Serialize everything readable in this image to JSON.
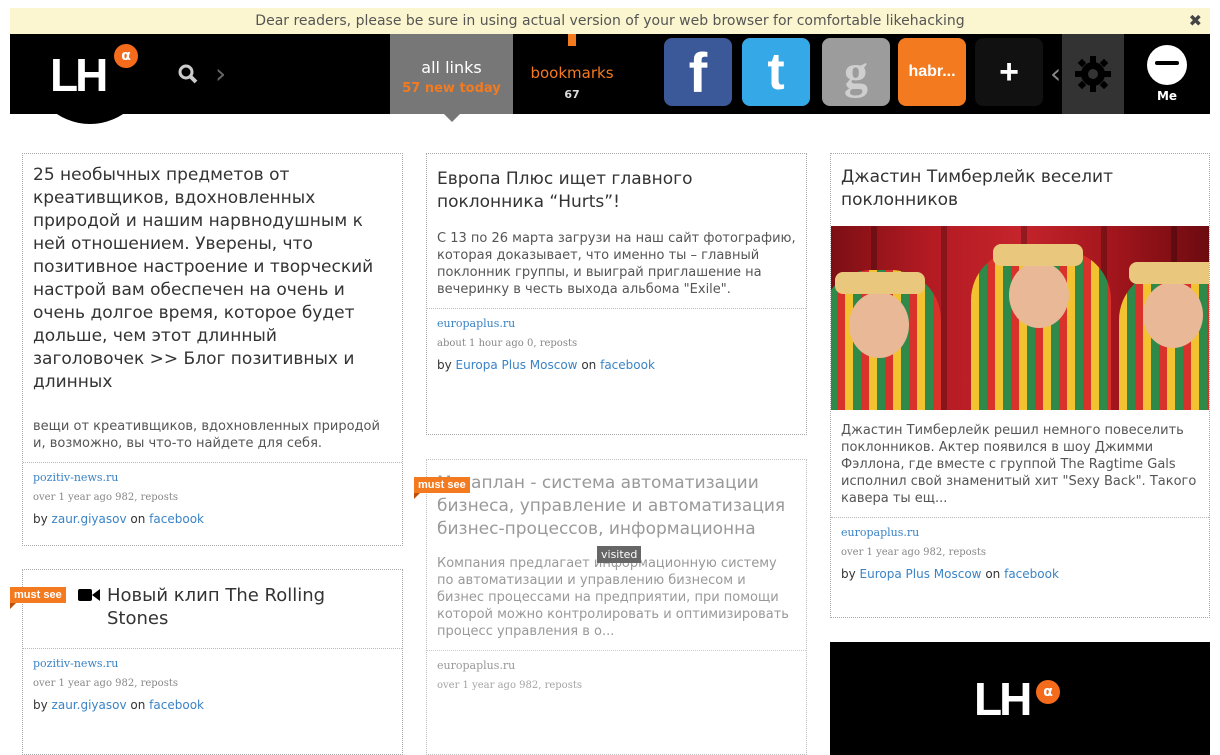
{
  "notice": {
    "text": "Dear readers, please be sure in using actual version of your web browser for comfortable likehacking",
    "close": "✖"
  },
  "header": {
    "logo": "LH",
    "logo_badge": "α",
    "search_icon": "search-icon",
    "tabs": {
      "all_links": {
        "label": "all links",
        "sub": "57 new today"
      },
      "bookmarks": {
        "label": "bookmarks",
        "count": "67"
      }
    },
    "social": {
      "facebook": "f",
      "twitter": "t",
      "google": "g",
      "habr": "habr...",
      "plus": "+"
    },
    "me_label": "Me"
  },
  "cards": [
    {
      "title": "25 необычных предметов от креативщиков, вдохновленных природой и нашим нарвнодушным к ней отношением. Уверены, что позитивное настроение и творческий настрой вам обеспечен на очень и очень долгое время, которое будет дольше, чем этот длинный заголовочек >> Блог позитивных и длинных",
      "desc": "вещи от креативщиков, вдохновленных природой и, возможно, вы что-то найдете для себя.",
      "source": "pozitiv-news.ru",
      "time": "over 1 year ago 982, reposts",
      "by_prefix": "by",
      "author": "zaur.giyasov",
      "on": "on",
      "network": "facebook"
    },
    {
      "badge": "must see",
      "title": "Новый клип The Rolling Stones",
      "source": "pozitiv-news.ru",
      "time": "over 1 year ago 982, reposts",
      "by_prefix": "by",
      "author": "zaur.giyasov",
      "on": "on",
      "network": "facebook"
    },
    {
      "title": "Европа Плюс ищет главного поклонника “Hurts”!",
      "desc": "С 13 по 26 марта загрузи на наш сайт фотографию, которая доказывает, что именно ты – главный поклонник группы, и выиграй приглашение на вечеринку в честь выхода альбома \"Exile\".",
      "source": "europaplus.ru",
      "time": "about 1 hour ago 0, reposts",
      "by_prefix": "by",
      "author": "Europa Plus Moscow",
      "on": "on",
      "network": "facebook"
    },
    {
      "badge": "must see",
      "visited": "visited",
      "title": "Мегаплан - система автоматизации бизнеса, управление и автоматизация бизнес-процессов, информационна",
      "desc": "Компания предлагает информационную систему по автоматизации и управлению бизнесом и бизнес процессами на предприятии, при помощи которой можно контролировать и оптимизировать процесс управления в о...",
      "source": "europaplus.ru",
      "time": "over 1 year ago 982, reposts"
    },
    {
      "title": "Джастин Тимберлейк веселит поклонников",
      "desc": "Джастин Тимберлейк решил немного повеселить поклонников. Актер появился в шоу Джимми Фэллона, где вместе с группой The Ragtime Gals исполнил свой знаменитый хит \"Sexy Back\". Такого кавера ты ещ...",
      "source": "europaplus.ru",
      "time": "over 1 year ago 982, reposts",
      "by_prefix": "by",
      "author": "Europa Plus Moscow",
      "on": "on",
      "network": "facebook"
    }
  ],
  "footer_logo": "LH",
  "footer_badge": "α",
  "colors": {
    "accent": "#f47a20",
    "link": "#3a83c5",
    "facebook": "#3b5998",
    "twitter": "#35a9e8"
  }
}
